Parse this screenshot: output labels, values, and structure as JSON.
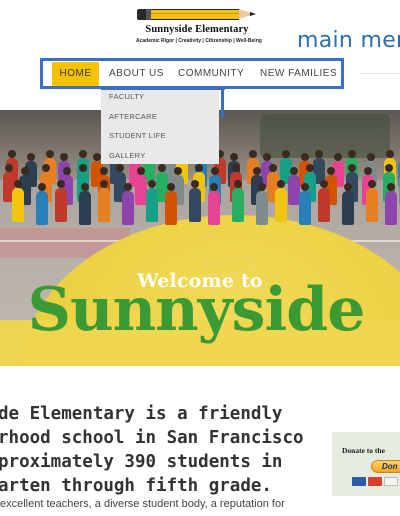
{
  "header": {
    "logo_name": "Sunnyside Elementary",
    "logo_tagline": "Academic Rigor | Creativity | Citizenship | Well-Being",
    "main_menu_label": "main men"
  },
  "nav": {
    "items": [
      {
        "label": "HOME",
        "active": true
      },
      {
        "label": "ABOUT US"
      },
      {
        "label": "COMMUNITY"
      },
      {
        "label": "NEW FAMILIES"
      }
    ],
    "dropdown": [
      {
        "label": "FACULTY"
      },
      {
        "label": "AFTERCARE"
      },
      {
        "label": "STUDENT LIFE"
      },
      {
        "label": "GALLERY"
      }
    ]
  },
  "hero": {
    "welcome": "Welcome to",
    "title": "Sunnyside"
  },
  "intro": {
    "lines": [
      "de Elementary is a friendly",
      "rhood school in San Francisco",
      "proximately 390 students in",
      "arten through fifth grade."
    ],
    "body": "excellent teachers, a diverse student body, a reputation for"
  },
  "donate": {
    "label": "Donate to the",
    "button": "Don"
  },
  "colors": {
    "accent_yellow": "#f5c200",
    "nav_outline": "#3c6ec4",
    "menu_blue": "#2f6fae",
    "title_green": "#3c9a35"
  }
}
